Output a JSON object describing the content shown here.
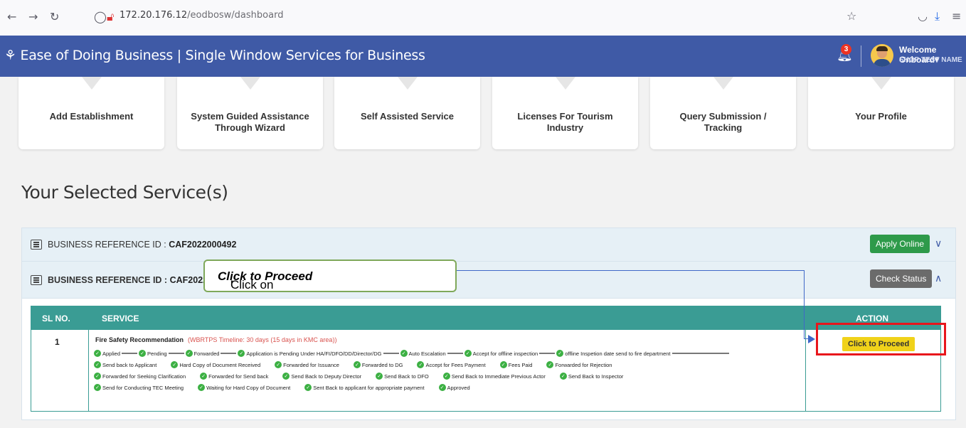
{
  "browser": {
    "url_host": "172.20.176.12",
    "url_path": "/eodbosw/dashboard"
  },
  "header": {
    "title": "Ease of Doing Business | Single Window Services for Business",
    "notification_count": "3",
    "welcome": "Welcome Onboard",
    "user_name": "SHOP TEST NAME"
  },
  "cards": [
    {
      "line1": "Add Establishment",
      "line2": ""
    },
    {
      "line1": "System Guided Assistance",
      "line2": "Through Wizard"
    },
    {
      "line1": "Self Assisted Service",
      "line2": ""
    },
    {
      "line1": "Licenses For Tourism",
      "line2": "Industry"
    },
    {
      "line1": "Query Submission /",
      "line2": "Tracking"
    },
    {
      "line1": "Your Profile",
      "line2": ""
    }
  ],
  "section_title": "Your Selected Service(s)",
  "references": [
    {
      "label": "BUSINESS REFERENCE ID :",
      "id": "CAF2022000492",
      "button": "Apply Online"
    },
    {
      "label": "BUSINESS REFERENCE ID :",
      "id": "CAF2022000",
      "button": "Check Status"
    }
  ],
  "table": {
    "headers": {
      "sl": "SL NO.",
      "service": "SERVICE",
      "action": "ACTION"
    },
    "row": {
      "sl": "1",
      "service": "Fire Safety Recommendation",
      "timeline": "(WBRTPS Timeline: 30 days (15 days in KMC area))",
      "action_button": "Click to Proceed"
    },
    "status_row1": [
      "Applied",
      "Pending",
      "Forwarded",
      "Application is Pending Under HA/FI/DFO/DD/Director/DG",
      "Auto Escalation",
      "Accept for offline inspection",
      "offline Inspetion date send to fire department"
    ],
    "status_row2": [
      "Send back to Applicant",
      "Hard Copy of Document Received",
      "Forwarded for Issuance",
      "Forwarded to DG",
      "Accept for Fees Payment",
      "Fees Paid",
      "Forwarded for Rejection"
    ],
    "status_row3": [
      "Forwarded for Seeking Clarification",
      "Forwarded for Send back",
      "Send Back to Deputy Director",
      "Send Back to DFO",
      "Send Back to Immediate Previous Actor",
      "Send Back to Inspector"
    ],
    "status_row4": [
      "Send for Conducting TEC Meeting",
      "Waiting for Hard Copy of Document",
      "Sent Back to applicant for appropriate payment",
      "Approved"
    ]
  },
  "callout": {
    "prefix": "Click on ",
    "quote_open": "‘",
    "emphasis": "Click to Proceed",
    "quote_close": "’"
  },
  "colors": {
    "header_bg": "#3f5aa6",
    "table_header_bg": "#3a9c94",
    "apply_green": "#2e9a4a",
    "proceed_yellow": "#f0d21a",
    "highlight_red": "#e8161c"
  }
}
